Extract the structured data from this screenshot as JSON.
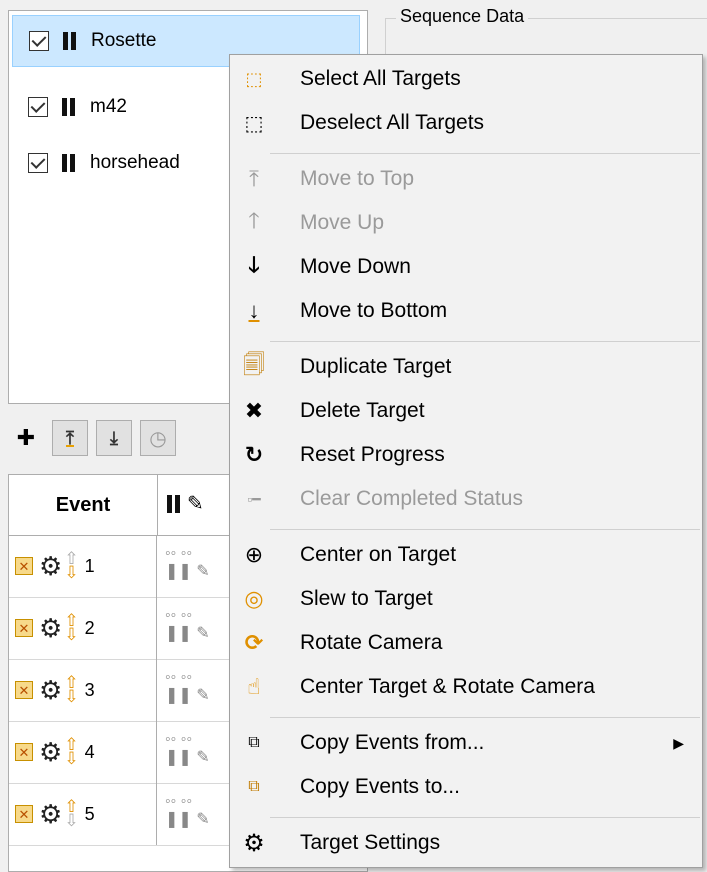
{
  "sequence_group_title": "Sequence Data",
  "targets": [
    {
      "name": "Rosette",
      "checked": true,
      "selected": true
    },
    {
      "name": "m42",
      "checked": true,
      "selected": false
    },
    {
      "name": "horsehead",
      "checked": true,
      "selected": false
    }
  ],
  "toolbar": {
    "add_icon": "plus-icon",
    "move_top_icon": "move-top-icon",
    "move_bottom_icon": "move-bottom-icon",
    "clock_icon": "clock-icon"
  },
  "event_table": {
    "header_event": "Event",
    "rows": [
      {
        "num": "1"
      },
      {
        "num": "2"
      },
      {
        "num": "3"
      },
      {
        "num": "4"
      },
      {
        "num": "5"
      }
    ]
  },
  "context_menu": {
    "items": [
      {
        "label": "Select All Targets",
        "icon": "select-all-icon",
        "enabled": true
      },
      {
        "label": "Deselect All Targets",
        "icon": "deselect-all-icon",
        "enabled": true
      },
      {
        "label": "Move to Top",
        "icon": "move-top-icon",
        "enabled": false
      },
      {
        "label": "Move Up",
        "icon": "arrow-up-icon",
        "enabled": false
      },
      {
        "label": "Move Down",
        "icon": "arrow-down-icon",
        "enabled": true
      },
      {
        "label": "Move to Bottom",
        "icon": "move-bottom-icon",
        "enabled": true
      },
      {
        "label": "Duplicate Target",
        "icon": "duplicate-icon",
        "enabled": true
      },
      {
        "label": "Delete Target",
        "icon": "delete-x-icon",
        "enabled": true
      },
      {
        "label": "Reset Progress",
        "icon": "reset-icon",
        "enabled": true
      },
      {
        "label": "Clear Completed Status",
        "icon": "clear-status-icon",
        "enabled": false
      },
      {
        "label": "Center on Target",
        "icon": "crosshair-icon",
        "enabled": true
      },
      {
        "label": "Slew to Target",
        "icon": "target-icon",
        "enabled": true
      },
      {
        "label": "Rotate Camera",
        "icon": "rotate-icon",
        "enabled": true
      },
      {
        "label": "Center Target & Rotate Camera",
        "icon": "center-rotate-icon",
        "enabled": true
      },
      {
        "label": "Copy Events from...",
        "icon": "copy-from-icon",
        "enabled": true,
        "submenu": true
      },
      {
        "label": "Copy Events to...",
        "icon": "copy-to-icon",
        "enabled": true
      },
      {
        "label": "Target Settings",
        "icon": "gear-icon",
        "enabled": true
      }
    ]
  },
  "colors": {
    "selection_bg": "#cce8ff",
    "accent_orange": "#e09000",
    "disabled_text": "#9a9a9a"
  }
}
